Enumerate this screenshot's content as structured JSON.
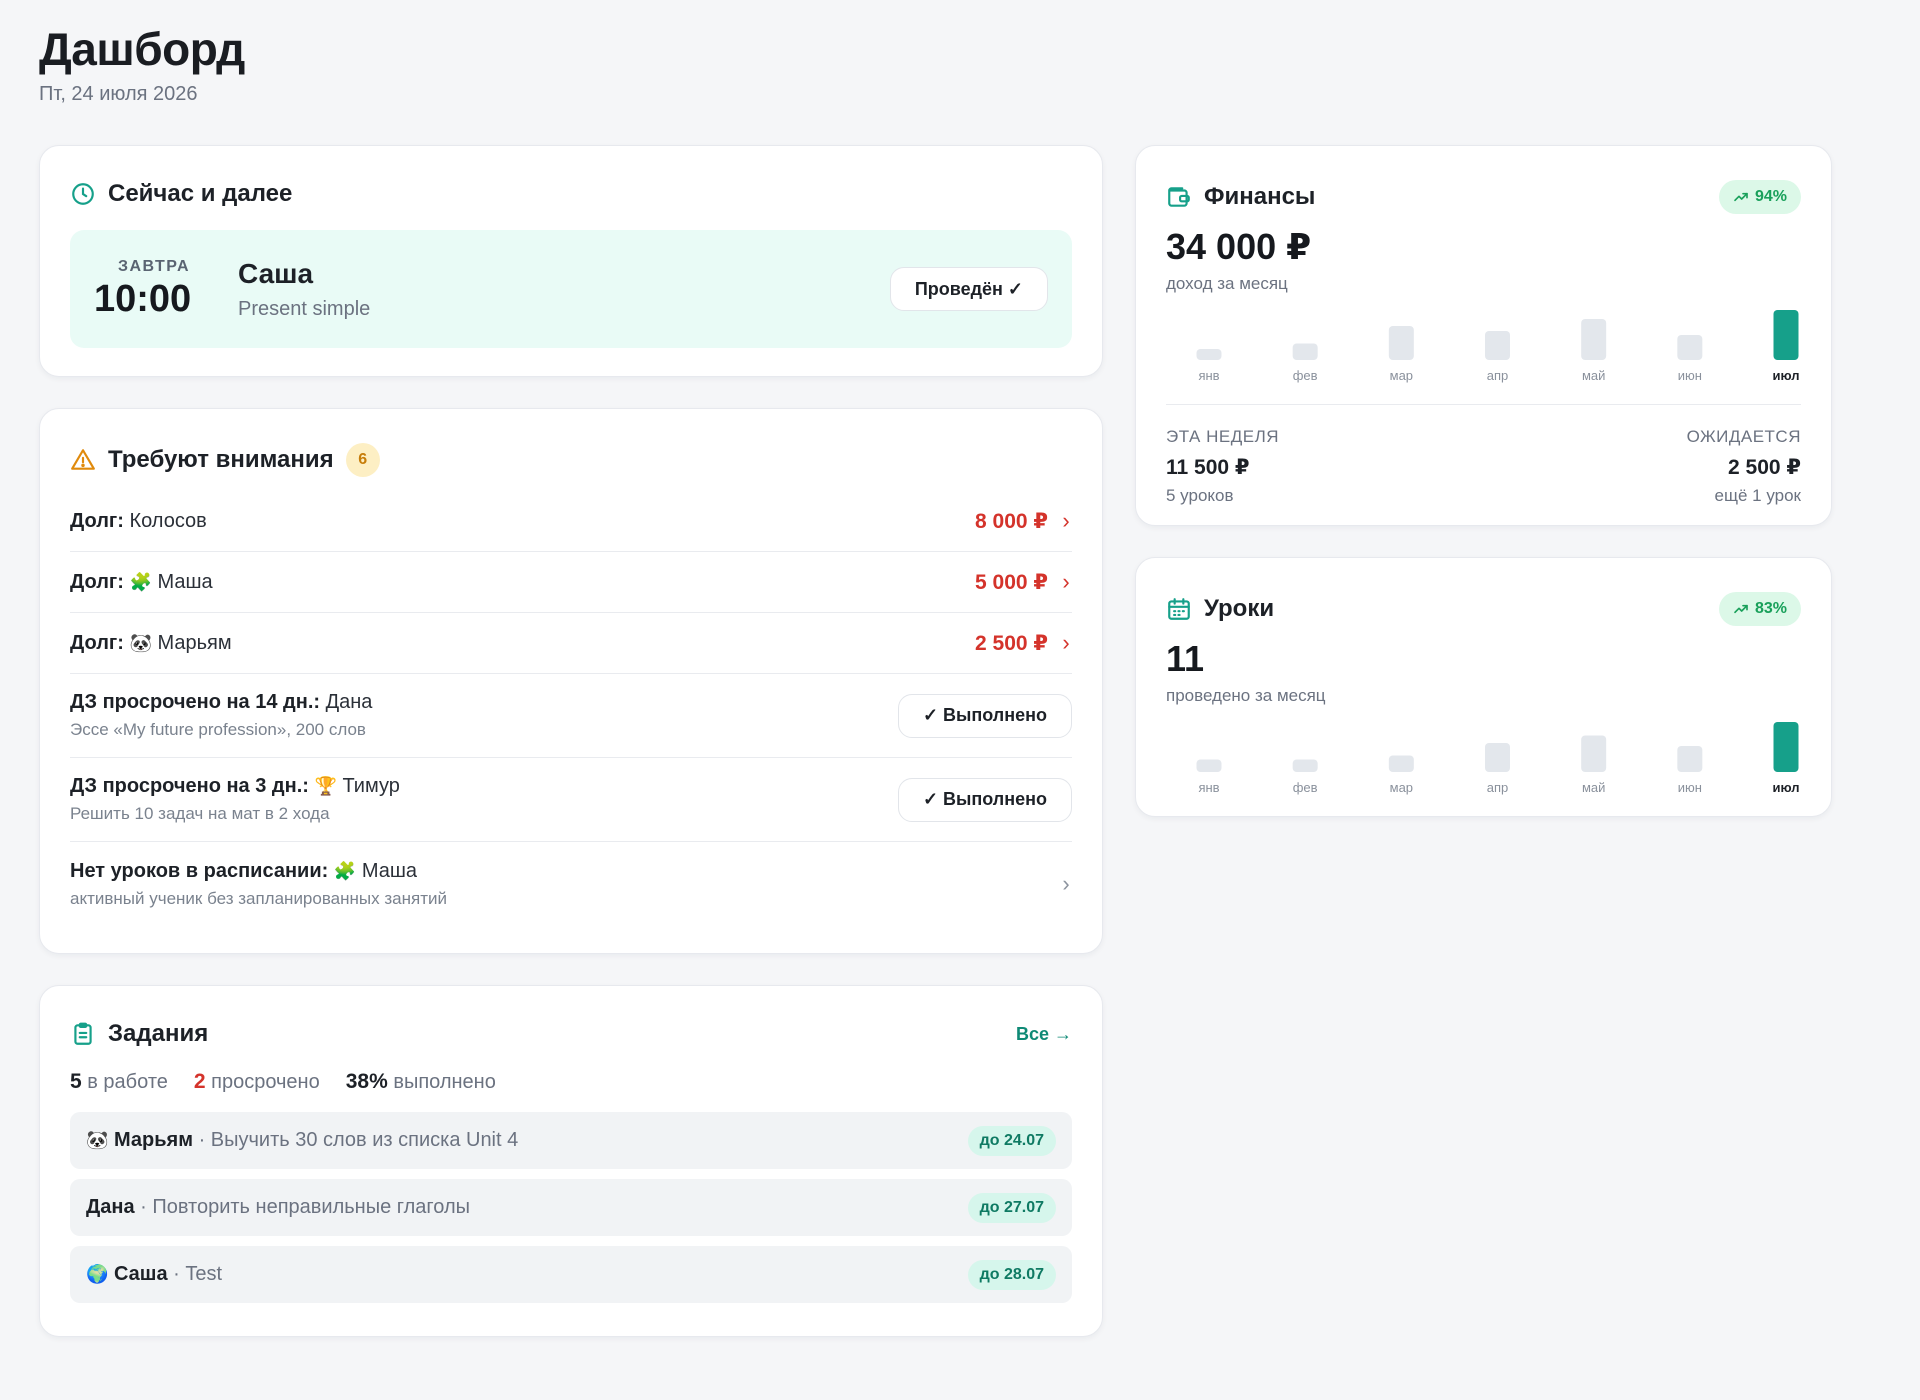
{
  "header": {
    "title": "Дашборд",
    "date": "Пт, 24 июля 2026"
  },
  "now": {
    "title": "Сейчас и далее",
    "lesson": {
      "day": "ЗАВТРА",
      "time": "10:00",
      "student": "Саша",
      "topic": "Present simple",
      "button": "Проведён ✓"
    }
  },
  "attention": {
    "title": "Требуют внимания",
    "count": "6",
    "items": [
      {
        "label": "Долг:",
        "name": "Колосов",
        "emoji": "",
        "amount": "8 000 ₽"
      },
      {
        "label": "Долг:",
        "name": "Маша",
        "emoji": "🧩",
        "amount": "5 000 ₽"
      },
      {
        "label": "Долг:",
        "name": "Марьям",
        "emoji": "🐼",
        "amount": "2 500 ₽"
      },
      {
        "label": "ДЗ просрочено на 14 дн.:",
        "name": "Дана",
        "emoji": "",
        "sub": "Эссе «My future profession», 200 слов",
        "button": "✓ Выполнено"
      },
      {
        "label": "ДЗ просрочено на 3 дн.:",
        "name": "Тимур",
        "emoji": "🏆",
        "sub": "Решить 10 задач на мат в 2 хода",
        "button": "✓ Выполнено"
      },
      {
        "label": "Нет уроков в расписании:",
        "name": "Маша",
        "emoji": "🧩",
        "sub": "активный ученик без запланированных занятий"
      }
    ]
  },
  "tasks": {
    "title": "Задания",
    "all_link": "Все →",
    "stats": [
      {
        "value": "5",
        "text": "в работе"
      },
      {
        "value": "2",
        "text": "просрочено"
      },
      {
        "value": "38%",
        "text": "выполнено"
      }
    ],
    "items": [
      {
        "emoji": "🐼",
        "name": "Марьям",
        "text": "· Выучить 30 слов из списка Unit 4",
        "due": "до 24.07"
      },
      {
        "emoji": "",
        "name": "Дана",
        "text": "· Повторить неправильные глаголы",
        "due": "до 27.07"
      },
      {
        "emoji": "🌍",
        "name": "Саша",
        "text": "· Test",
        "due": "до 28.07"
      }
    ]
  },
  "finance": {
    "title": "Финансы",
    "trend": "94%",
    "value": "34 000 ₽",
    "sub": "доход за месяц",
    "week": {
      "label": "ЭТА НЕДЕЛЯ",
      "value": "11 500 ₽",
      "sub": "5 уроков"
    },
    "expected": {
      "label": "ОЖИДАЕТСЯ",
      "value": "2 500 ₽",
      "sub": "ещё 1 урок"
    }
  },
  "lessons": {
    "title": "Уроки",
    "trend": "83%",
    "value": "11",
    "sub": "проведено за месяц"
  },
  "colors": {
    "accent": "#16a08a",
    "bar": "#e3e7ec",
    "debt": "#d4332b",
    "trend": "#19a05a"
  },
  "chart_data": [
    {
      "type": "bar",
      "categories": [
        "янв",
        "фев",
        "мар",
        "апр",
        "май",
        "июн",
        "июл"
      ],
      "values": [
        0.22,
        0.33,
        0.68,
        0.58,
        0.82,
        0.5,
        1.0
      ],
      "highlight_index": 6
    },
    {
      "type": "bar",
      "categories": [
        "янв",
        "фев",
        "мар",
        "апр",
        "май",
        "июн",
        "июл"
      ],
      "values": [
        0.25,
        0.25,
        0.33,
        0.58,
        0.73,
        0.52,
        1.0
      ],
      "highlight_index": 6
    }
  ]
}
